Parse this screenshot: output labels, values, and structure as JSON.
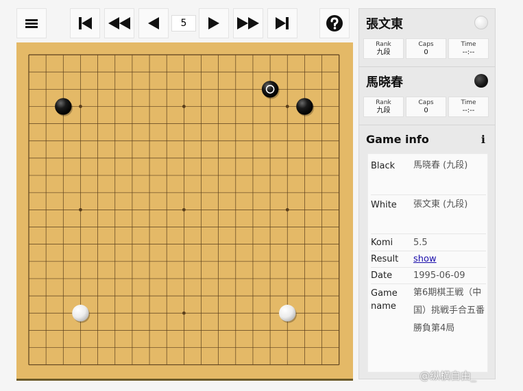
{
  "toolbar": {
    "menu_icon": "menu-icon",
    "first_icon": "skip-to-start-icon",
    "rewind_icon": "fast-rewind-icon",
    "prev_icon": "step-back-icon",
    "move_number": "5",
    "next_icon": "step-forward-icon",
    "forward_icon": "fast-forward-icon",
    "last_icon": "skip-to-end-icon",
    "help_icon": "help-icon"
  },
  "board": {
    "size": 19,
    "star_points": [
      [
        3,
        3
      ],
      [
        3,
        9
      ],
      [
        3,
        15
      ],
      [
        9,
        3
      ],
      [
        9,
        9
      ],
      [
        9,
        15
      ],
      [
        15,
        3
      ],
      [
        15,
        9
      ],
      [
        15,
        15
      ]
    ],
    "stones": [
      {
        "color": "black",
        "col": 14,
        "row": 2,
        "last_move": true
      },
      {
        "color": "black",
        "col": 2,
        "row": 3
      },
      {
        "color": "black",
        "col": 16,
        "row": 3
      },
      {
        "color": "white",
        "col": 3,
        "row": 15
      },
      {
        "color": "white",
        "col": 15,
        "row": 15
      }
    ],
    "colors": {
      "wood": "#e4b967",
      "line": "#5a3f1c",
      "black_stone": "#111111",
      "white_stone": "#f4f4f4"
    }
  },
  "players": {
    "white": {
      "name": "張文東",
      "stone_icon": "white-stone-icon",
      "rank_label": "Rank",
      "rank": "九段",
      "caps_label": "Caps",
      "caps": "0",
      "time_label": "Time",
      "time": "--:--"
    },
    "black": {
      "name": "馬晓春",
      "stone_icon": "black-stone-icon",
      "rank_label": "Rank",
      "rank": "九段",
      "caps_label": "Caps",
      "caps": "0",
      "time_label": "Time",
      "time": "--:--"
    }
  },
  "game_info": {
    "title": "Game info",
    "info_icon": "info-icon",
    "info_glyph": "i",
    "rows": {
      "black": {
        "key": "Black",
        "value": "馬晓春 (九段)"
      },
      "white": {
        "key": "White",
        "value": "張文東 (九段)"
      },
      "komi": {
        "key": "Komi",
        "value": "5.5"
      },
      "result": {
        "key": "Result",
        "value": "show"
      },
      "date": {
        "key": "Date",
        "value": "1995-06-09"
      },
      "game_name": {
        "key": "Game name",
        "value": "第6期棋王戦（中国）挑戦手合五番勝負第4局"
      }
    }
  },
  "watermark": "@纵横自由_"
}
